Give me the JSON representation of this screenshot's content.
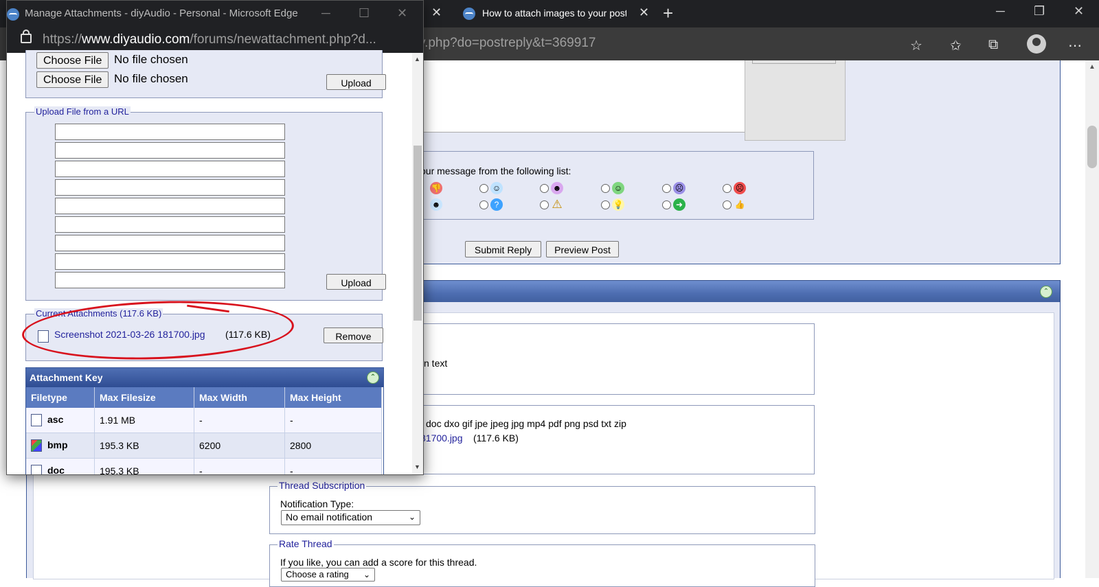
{
  "browser": {
    "active_tab_title": "How to attach images to your post",
    "address_visible": "y.php?do=postreply&t=369917",
    "window_controls": [
      "minimize-icon",
      "restore-icon",
      "close-icon"
    ],
    "toolbar_icons": [
      "add-favorite-icon",
      "favorites-icon",
      "collections-icon",
      "profile-icon",
      "more-icon"
    ]
  },
  "background_page": {
    "icon_prompt": "our message from the following list:",
    "icons_row1": [
      "thumbs-down",
      "smile",
      "grin-purple",
      "big-grin",
      "sad",
      "angry"
    ],
    "icons_row2": [
      "cool",
      "question",
      "warning",
      "idea",
      "arrow",
      "thumbs-up"
    ],
    "submit_label": "Submit Reply",
    "preview_label": "Preview Post",
    "text_fragment": "n text",
    "allowed_types": "doc dxo gif jpe jpeg jpg mp4 pdf png psd txt zip",
    "attachment_fragment": "81700.jpg",
    "attachment_size": "(117.6 KB)",
    "subscription": {
      "legend": "Thread Subscription",
      "label": "Notification Type:",
      "value": "No email notification"
    },
    "rate": {
      "legend": "Rate Thread",
      "text": "If you like, you can add a score for this thread.",
      "select_value": "Choose a rating"
    }
  },
  "popup": {
    "window_title": "Manage Attachments - diyAudio - Personal - Microsoft Edge",
    "url_prefix": "https://",
    "url_host": "www.diyaudio.com",
    "url_path": "/forums/newattachment.php?d...",
    "choose_file_label": "Choose File",
    "no_file_text": "No file chosen",
    "upload_label": "Upload",
    "url_legend": "Upload File from a URL",
    "current_legend": "Current Attachments (117.6 KB)",
    "attachment_name": "Screenshot 2021-03-26 181700.jpg",
    "attachment_size": "(117.6 KB)",
    "remove_label": "Remove",
    "key_title": "Attachment Key",
    "key_headers": [
      "Filetype",
      "Max Filesize",
      "Max Width",
      "Max Height"
    ],
    "key_rows": [
      {
        "type": "asc",
        "size": "1.91 MB",
        "width": "-",
        "height": "-"
      },
      {
        "type": "bmp",
        "size": "195.3 KB",
        "width": "6200",
        "height": "2800"
      },
      {
        "type": "doc",
        "size": "195.3 KB",
        "width": "-",
        "height": "-"
      }
    ]
  },
  "colors": {
    "link": "#22229c",
    "header_blue": "#5b7bc0",
    "annotation_red": "#d8121d"
  }
}
